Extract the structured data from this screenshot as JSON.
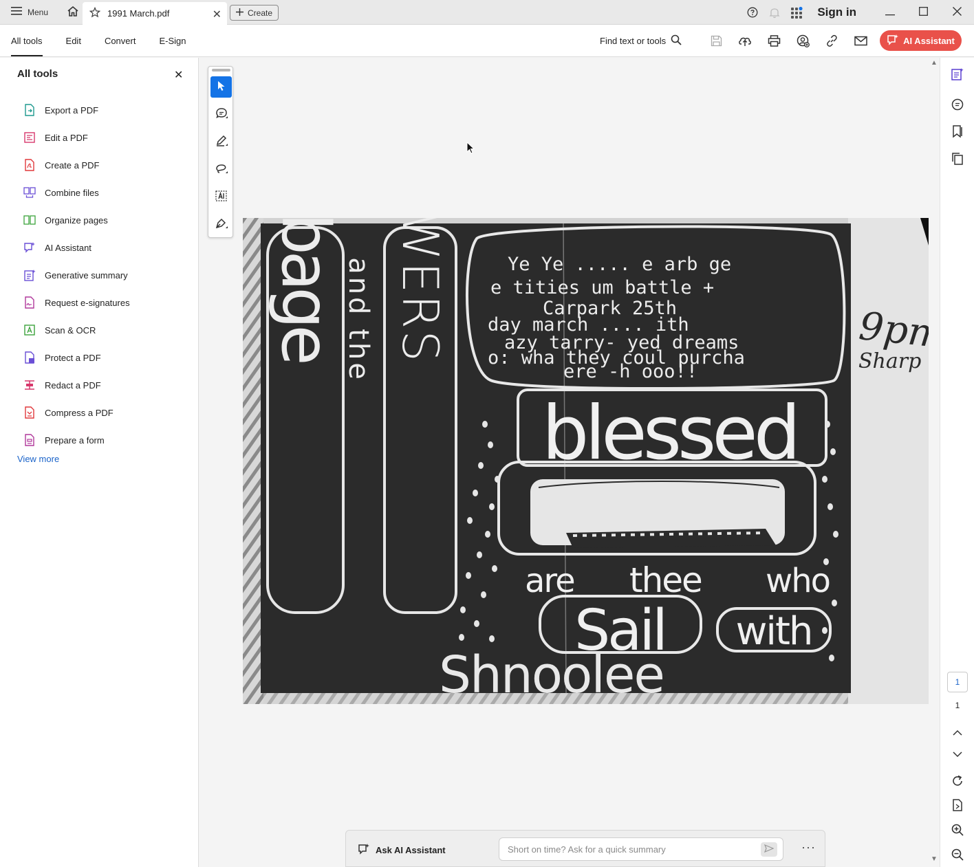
{
  "titlebar": {
    "menu_label": "Menu",
    "tab_title": "1991 March.pdf",
    "tab_close": "✕",
    "create_label": "Create",
    "sign_in": "Sign in"
  },
  "toolbar": {
    "tabs": [
      {
        "label": "All tools",
        "active": true
      },
      {
        "label": "Edit"
      },
      {
        "label": "Convert"
      },
      {
        "label": "E-Sign"
      }
    ],
    "find_label": "Find text or tools",
    "ai_assistant_label": "AI Assistant"
  },
  "sidebar": {
    "title": "All tools",
    "close": "✕",
    "items": [
      {
        "label": "Export a PDF",
        "icon": "export-pdf-icon",
        "color": "#1f9a8f"
      },
      {
        "label": "Edit a PDF",
        "icon": "edit-pdf-icon",
        "color": "#d7376b"
      },
      {
        "label": "Create a PDF",
        "icon": "create-pdf-icon",
        "color": "#e0383c"
      },
      {
        "label": "Combine files",
        "icon": "combine-files-icon",
        "color": "#6a4fd6"
      },
      {
        "label": "Organize pages",
        "icon": "organize-pages-icon",
        "color": "#3ca33c"
      },
      {
        "label": "AI Assistant",
        "icon": "ai-assistant-icon",
        "color": "#6a4fd6"
      },
      {
        "label": "Generative summary",
        "icon": "generative-summary-icon",
        "color": "#6a4fd6"
      },
      {
        "label": "Request e-signatures",
        "icon": "request-esignatures-icon",
        "color": "#b1389b"
      },
      {
        "label": "Scan & OCR",
        "icon": "scan-ocr-icon",
        "color": "#3ca33c"
      },
      {
        "label": "Protect a PDF",
        "icon": "protect-pdf-icon",
        "color": "#6a4fd6"
      },
      {
        "label": "Redact a PDF",
        "icon": "redact-pdf-icon",
        "color": "#d7376b"
      },
      {
        "label": "Compress a PDF",
        "icon": "compress-pdf-icon",
        "color": "#e0383c"
      },
      {
        "label": "Prepare a form",
        "icon": "prepare-form-icon",
        "color": "#b1389b"
      }
    ],
    "view_more": "View more"
  },
  "document": {
    "flyer": {
      "left_vertical": "garbage",
      "and_the": "and the",
      "flowers": "FLOWERS",
      "bubble_lines": [
        "Ye  Ye .....  e    arb  ge",
        "e  tities    um  battle  +",
        "Carpark        25th",
        "day   march    ....  ith",
        "azy  tarry-  yed  dreams",
        "o:  wha   they coul   purcha",
        "ere  -h   ooo!!"
      ],
      "time": "9pm",
      "time_sub": "Sharp",
      "blessed": "blessed",
      "are": "are",
      "thee": "thee",
      "who": "who",
      "sail": "Sail",
      "with": "with",
      "bottom": "Shnoolee"
    }
  },
  "ai_bar": {
    "label": "Ask AI Assistant",
    "placeholder": "Short on time? Ask for a quick summary",
    "more": "···"
  },
  "page_nav": {
    "current": "1",
    "total": "1"
  }
}
